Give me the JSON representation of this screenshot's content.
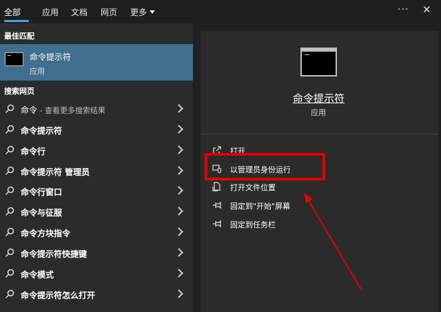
{
  "tabs": [
    {
      "label": "全部"
    },
    {
      "label": "应用"
    },
    {
      "label": "文档"
    },
    {
      "label": "网页"
    },
    {
      "label": "更多"
    }
  ],
  "top_actions": {
    "more_options": "···",
    "close": "✕"
  },
  "left": {
    "best_match_header": "最佳匹配",
    "best_match": {
      "title": "命令提示符",
      "subtitle": "应用"
    },
    "web_search_header": "搜索网页",
    "results": [
      {
        "label": "命令",
        "suffix": " - 查看更多搜索结果"
      },
      {
        "label": "命令提示符",
        "suffix": ""
      },
      {
        "label": "命令行",
        "suffix": ""
      },
      {
        "label": "命令提示符 管理员",
        "suffix": ""
      },
      {
        "label": "命令行窗口",
        "suffix": ""
      },
      {
        "label": "命令与征服",
        "suffix": ""
      },
      {
        "label": "命令方块指令",
        "suffix": ""
      },
      {
        "label": "命令提示符快捷键",
        "suffix": ""
      },
      {
        "label": "命令模式",
        "suffix": ""
      },
      {
        "label": "命令提示符怎么打开",
        "suffix": ""
      }
    ]
  },
  "right": {
    "app_title": "命令提示符",
    "app_subtitle": "应用",
    "actions": [
      {
        "label": "打开",
        "icon": "open-icon"
      },
      {
        "label": "以管理员身份运行",
        "icon": "shield-icon"
      },
      {
        "label": "打开文件位置",
        "icon": "folder-icon"
      },
      {
        "label": "固定到\"开始\"屏幕",
        "icon": "pin-icon"
      },
      {
        "label": "固定到任务栏",
        "icon": "pin-icon"
      }
    ]
  },
  "colors": {
    "accent": "#4aa0e0",
    "selected": "#3f6e8f",
    "annotation": "#e00000"
  }
}
